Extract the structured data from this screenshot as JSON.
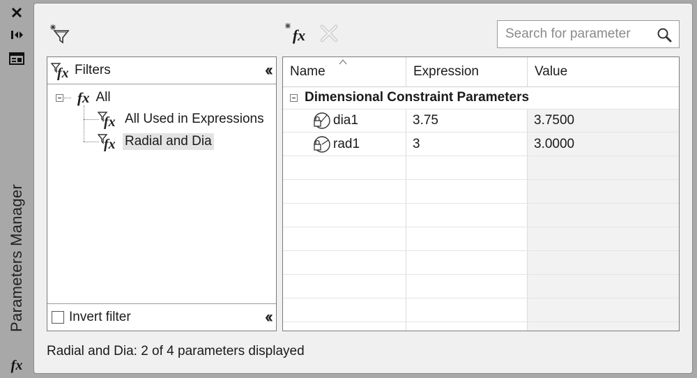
{
  "window": {
    "title": "Parameters Manager",
    "strip_icons": [
      "close-icon",
      "auto-hide-icon",
      "properties-icon",
      "fx-icon"
    ]
  },
  "toolbar": {
    "fx_symbol": "fx",
    "search_placeholder": "Search for parameter"
  },
  "filters": {
    "header": "Filters",
    "tree": [
      {
        "label": "All",
        "icon": "fx-icon",
        "level": 0,
        "selected": false
      },
      {
        "label": "All Used in Expressions",
        "icon": "filter-fx-icon",
        "level": 1,
        "selected": false
      },
      {
        "label": "Radial and Dia",
        "icon": "filter-fx-icon",
        "level": 1,
        "selected": true
      }
    ],
    "invert_label": "Invert filter"
  },
  "grid": {
    "columns": [
      "Name",
      "Expression",
      "Value"
    ],
    "group": "Dimensional Constraint Parameters",
    "rows": [
      {
        "name": "dia1",
        "expression": "3.75",
        "value": "3.7500"
      },
      {
        "name": "rad1",
        "expression": "3",
        "value": "3.0000"
      }
    ]
  },
  "status": "Radial and Dia: 2 of 4 parameters displayed"
}
